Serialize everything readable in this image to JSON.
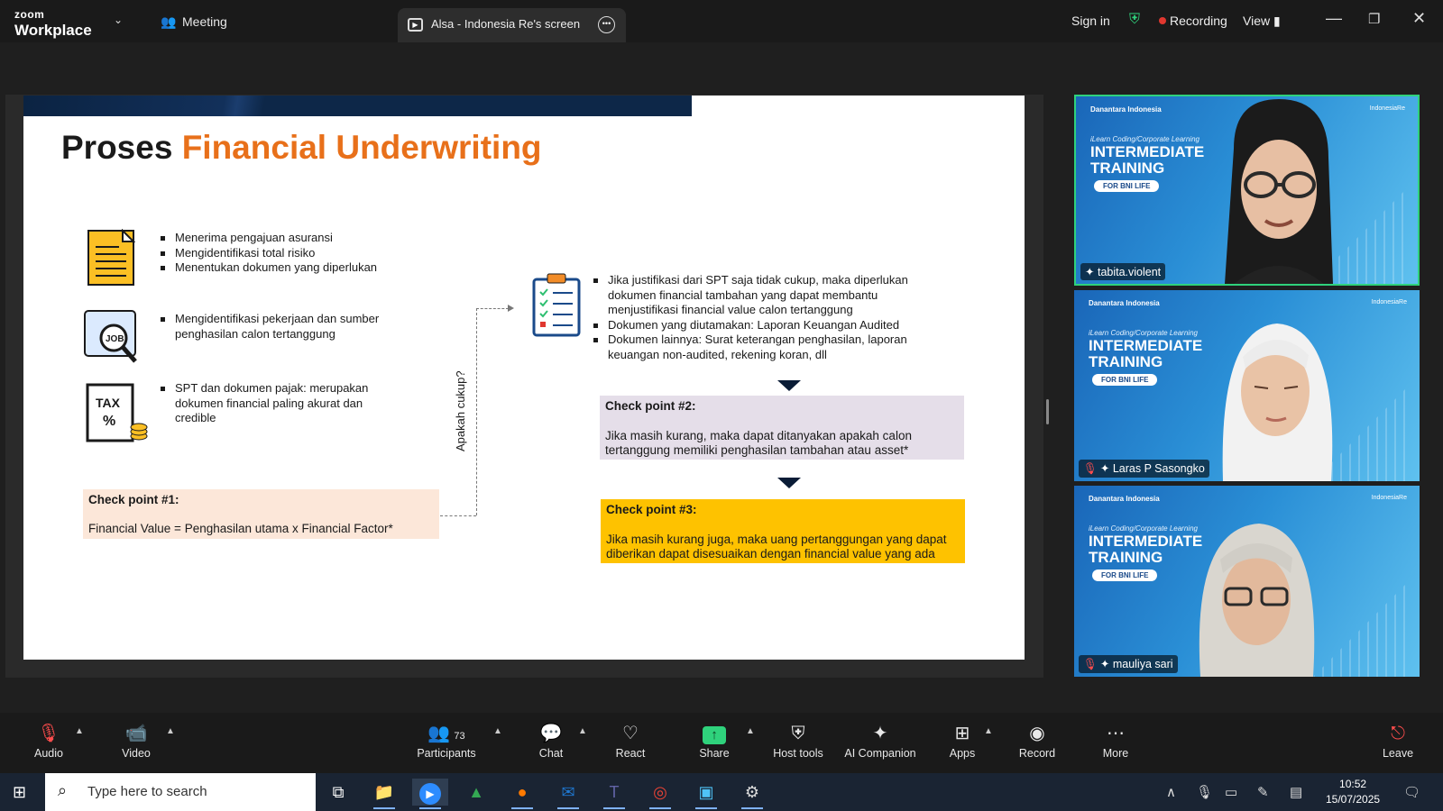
{
  "topbar": {
    "logo_line1": "zoom",
    "logo_line2": "Workplace",
    "meeting_tab": "Meeting",
    "share_tab": "Alsa - Indonesia Re's screen",
    "sign_in": "Sign in",
    "recording": "Recording",
    "view": "View"
  },
  "slide": {
    "title_plain": "Proses ",
    "title_highlight": "Financial Underwriting",
    "group1": [
      "Menerima pengajuan asuransi",
      "Mengidentifikasi total risiko",
      "Menentukan dokumen yang diperlukan"
    ],
    "group2": [
      "Mengidentifikasi pekerjaan dan sumber penghasilan calon tertanggung"
    ],
    "group3": [
      "SPT dan dokumen pajak: merupakan dokumen financial paling akurat dan credible"
    ],
    "icon_job": "JOB",
    "icon_tax": "TAX",
    "checkpoint1_title": "Check point #1:",
    "checkpoint1_text": "Financial Value = Penghasilan utama x Financial Factor*",
    "vertical_label": "Apakah cukup?",
    "right_bullets": [
      "Jika justifikasi dari SPT saja tidak cukup, maka diperlukan dokumen financial tambahan yang dapat membantu menjustifikasi financial value calon tertanggung",
      "Dokumen yang diutamakan: Laporan Keuangan Audited",
      "Dokumen lainnya: Surat keterangan penghasilan, laporan keuangan non-audited, rekening koran, dll"
    ],
    "checkpoint2_title": "Check point #2:",
    "checkpoint2_text": "Jika masih kurang, maka dapat ditanyakan apakah calon tertanggung memiliki penghasilan tambahan atau asset*",
    "checkpoint3_title": "Check point #3:",
    "checkpoint3_text": "Jika masih kurang juga, maka uang pertanggungan yang dapat diberikan dapat disesuaikan dengan financial value yang ada",
    "colors": {
      "highlight": "#e8701a",
      "cp1_bg": "#fce7d9",
      "cp2_bg": "#e5dee9",
      "cp3_bg": "#fec200",
      "band": "#0b2342"
    }
  },
  "participants_tiles": [
    {
      "name": "tabita.violent",
      "active": true,
      "muted": false
    },
    {
      "name": "Laras P Sasongko",
      "active": false,
      "muted": true
    },
    {
      "name": "mauliya sari",
      "active": false,
      "muted": true
    }
  ],
  "tile_banner": {
    "brand": "Danantara Indonesia",
    "brand_right": "IndonesiaRe",
    "sub": "iLearn Coding/Corporate Learning",
    "line1": "INTERMEDIATE",
    "line2": "TRAINING",
    "pill": "FOR BNI LIFE"
  },
  "toolbar": {
    "audio": "Audio",
    "video": "Video",
    "participants": "Participants",
    "participants_count": "73",
    "chat": "Chat",
    "react": "React",
    "share": "Share",
    "host_tools": "Host tools",
    "ai_companion": "AI Companion",
    "apps": "Apps",
    "record": "Record",
    "more": "More",
    "leave": "Leave"
  },
  "taskbar": {
    "search_placeholder": "Type here to search",
    "time": "10:52",
    "date": "15/07/2025"
  }
}
